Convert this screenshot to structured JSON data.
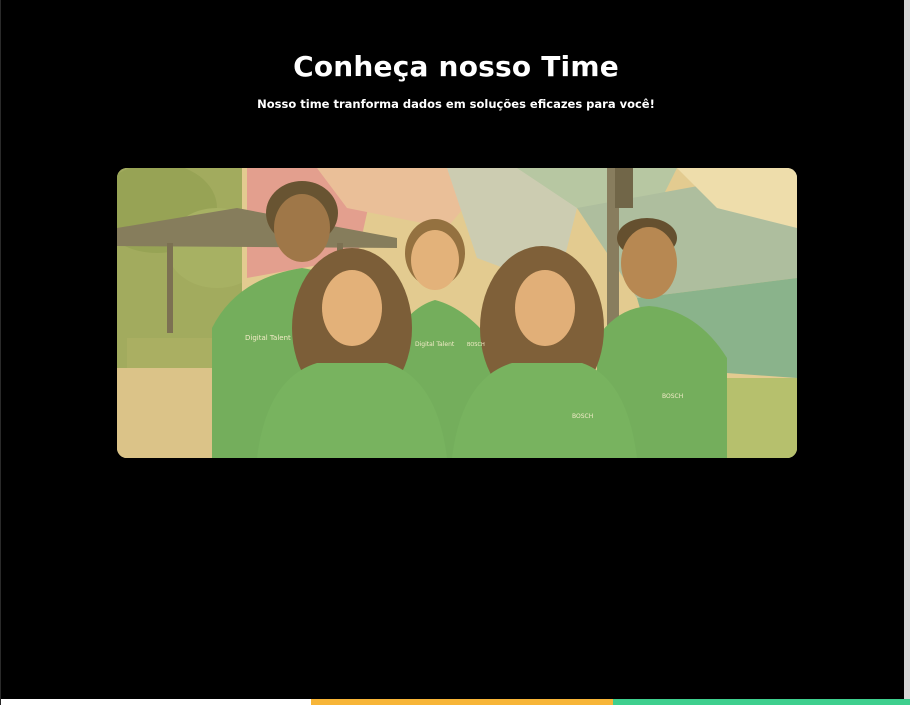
{
  "section": {
    "title": "Conheça nosso Time",
    "subtitle": "Nosso time tranforma dados em soluções eficazes para você!"
  },
  "team_photo": {
    "alt": "",
    "shirt_text_left": "Digital Talent",
    "shirt_text_brand": "BOSCH"
  },
  "bottom_bar": {
    "colors": [
      "#ffffff",
      "#f7b538",
      "#3ecf8e"
    ]
  },
  "colors": {
    "background": "#000000",
    "text": "#ffffff",
    "shirt": "#3f9f52"
  }
}
